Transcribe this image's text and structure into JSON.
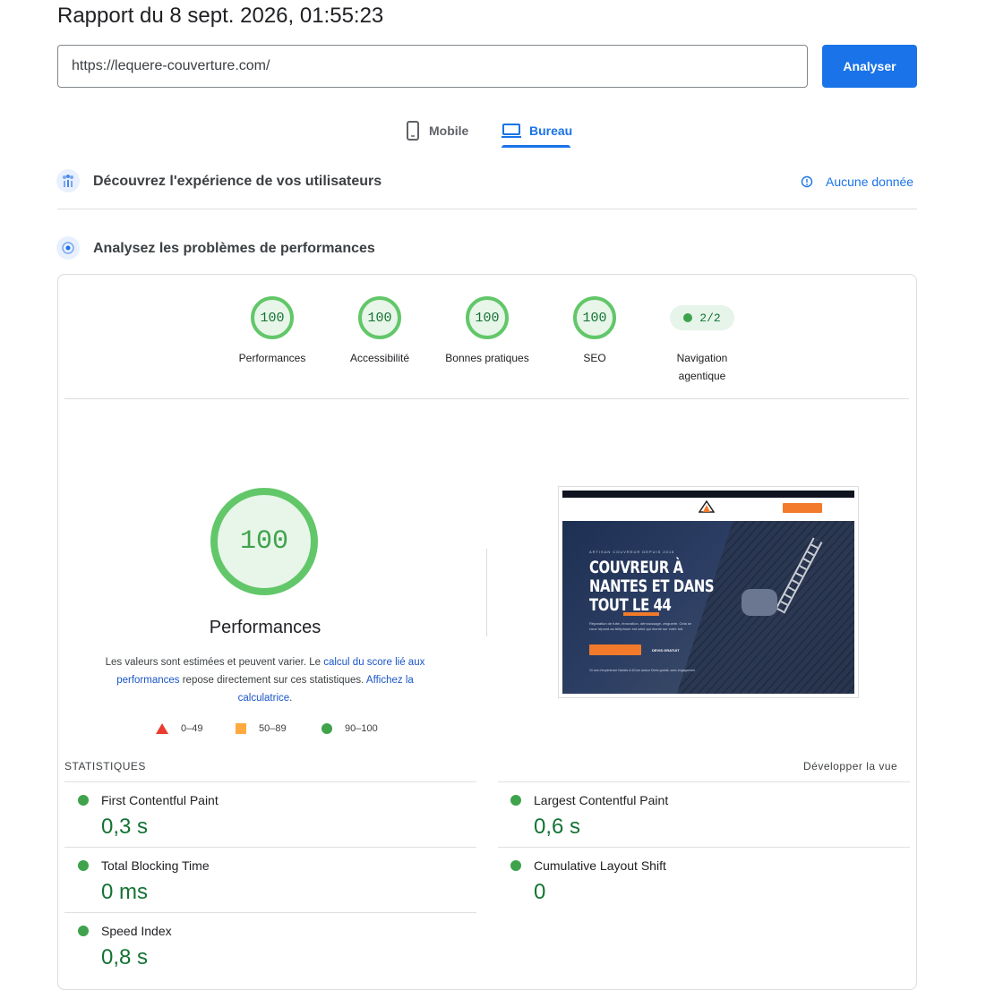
{
  "header": {
    "title": "Rapport du 8 sept. 2026, 01:55:23",
    "url_value": "https://lequere-couverture.com/",
    "analyze_label": "Analyser"
  },
  "tabs": [
    {
      "label": "Mobile",
      "icon": "smartphone-icon",
      "active": false
    },
    {
      "label": "Bureau",
      "icon": "laptop-icon",
      "active": true
    }
  ],
  "sections": {
    "users": {
      "title": "Découvrez l'expérience de vos utilisateurs",
      "no_data": "Aucune donnée"
    },
    "perf": {
      "title": "Analysez les problèmes de performances"
    }
  },
  "scores": [
    {
      "label": "Performances",
      "value": "100"
    },
    {
      "label": "Accessibilité",
      "value": "100"
    },
    {
      "label": "Bonnes pratiques",
      "value": "100"
    },
    {
      "label": "SEO",
      "value": "100"
    }
  ],
  "agentic": {
    "label_line1": "Navigation",
    "label_line2": "agentique",
    "value": "2/2"
  },
  "main_score": {
    "value": "100",
    "title": "Performances",
    "desc_1": "Les valeurs sont estimées et peuvent varier. Le ",
    "desc_link1": "calcul du score lié aux performances",
    "desc_2": " repose directement sur ces statistiques. ",
    "desc_link2": "Affichez la calculatrice",
    "desc_3": "."
  },
  "legend": {
    "fail": "0–49",
    "average": "50–89",
    "pass": "90–100"
  },
  "colors": {
    "accent": "#1a73e8",
    "pass": "#3ea34b",
    "average": "#ffa93f",
    "fail": "#eb3b2f"
  },
  "screenshot": {
    "subtitle": "ARTISAN COUVREUR DEPUIS 2016",
    "headline": "COUVREUR À\nNANTES ET DANS\nTOUT LE 44",
    "para": "Réparation de fuite, rénovation, démoussage, zinguerie. Cela se\nvoue répond au téléphone est celui qui monte sur votre toit.",
    "cta": "DEVIS GRATUIT",
    "footer": "10 ans d'expérience     Nantes & 60 km autour     Devis gratuit, sans engagement"
  },
  "stats": {
    "heading": "STATISTIQUES",
    "expand": "Développer la vue",
    "metrics": [
      {
        "label": "First Contentful Paint",
        "value": "0,3 s"
      },
      {
        "label": "Largest Contentful Paint",
        "value": "0,6 s"
      },
      {
        "label": "Total Blocking Time",
        "value": "0 ms"
      },
      {
        "label": "Cumulative Layout Shift",
        "value": "0"
      },
      {
        "label": "Speed Index",
        "value": "0,8 s"
      }
    ]
  }
}
